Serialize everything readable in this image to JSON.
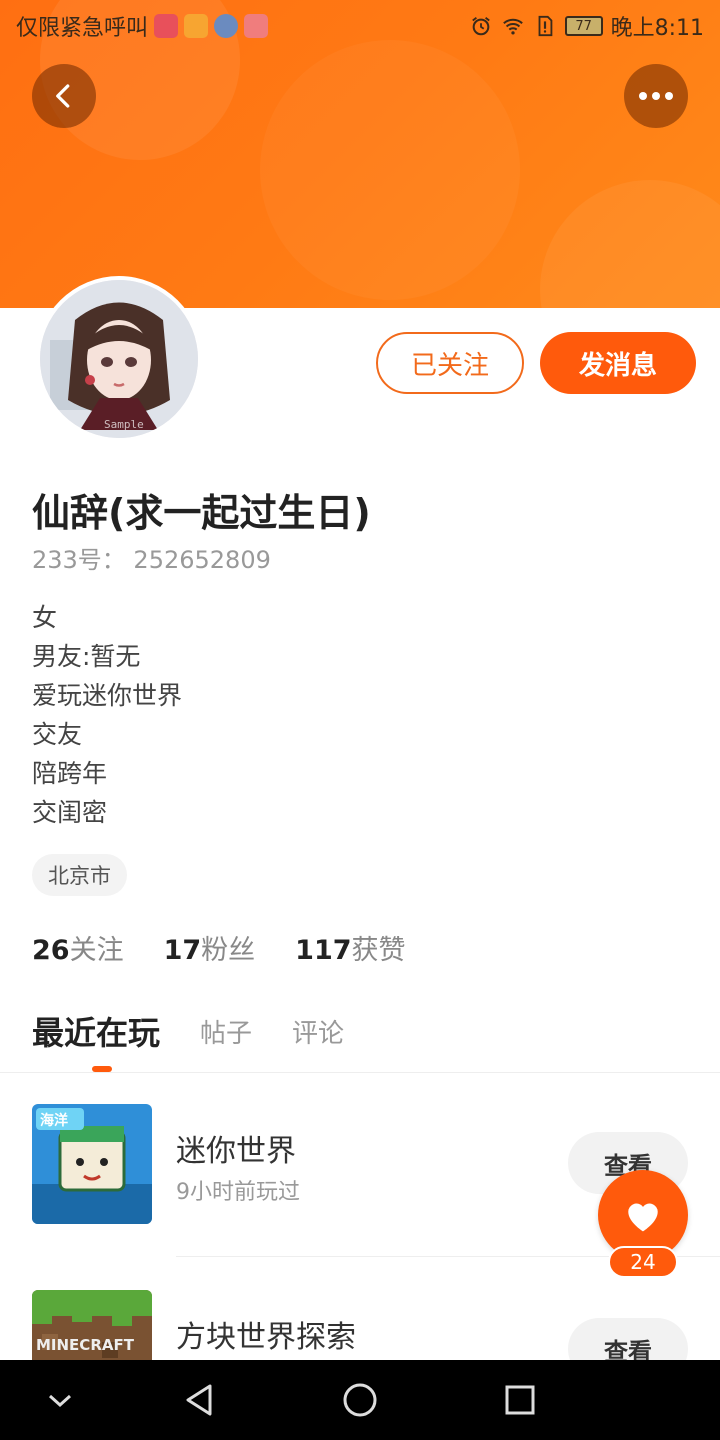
{
  "status_bar": {
    "left_text": "仅限紧急呼叫",
    "time": "晚上8:11",
    "battery": "77",
    "notification_icons": [
      "app-store-icon",
      "video-app-icon",
      "browser-app-icon",
      "tool-app-icon"
    ],
    "right_icons": [
      "alarm-icon",
      "wifi-icon",
      "sim-alert-icon",
      "battery-icon"
    ]
  },
  "header": {
    "back_icon": "chevron-left-icon",
    "more_icon": "more-horizontal-icon",
    "banner_color": "#ff7a14"
  },
  "profile": {
    "follow_label": "已关注",
    "message_label": "发消息",
    "nickname": "仙辞(求一起过生日)",
    "uid": "233号： 252652809",
    "bio_lines": [
      "女",
      "男友:暂无",
      "爱玩迷你世界",
      "交友",
      "陪跨年",
      "交闺密"
    ],
    "city": "北京市",
    "avatar_watermark": "Sample",
    "stats": [
      {
        "num": "26",
        "label": "关注"
      },
      {
        "num": "17",
        "label": "粉丝"
      },
      {
        "num": "117",
        "label": "获赞"
      }
    ]
  },
  "tabs": [
    {
      "label": "最近在玩",
      "active": true
    },
    {
      "label": "帖子",
      "active": false
    },
    {
      "label": "评论",
      "active": false
    }
  ],
  "games": [
    {
      "name": "迷你世界",
      "time": "9小时前玩过",
      "action": "查看",
      "thumb_text": "海洋"
    },
    {
      "name": "方块世界探索",
      "time": "",
      "action": "查看",
      "thumb_text": "MINECRAFT"
    }
  ],
  "like_fab": {
    "icon": "heart-icon",
    "count": "24"
  },
  "nav_bar": [
    "collapse-icon",
    "back-triangle-icon",
    "home-circle-icon",
    "recents-square-icon"
  ],
  "colors": {
    "accent": "#ff5a0c",
    "follow_outline": "#f26a1b"
  }
}
